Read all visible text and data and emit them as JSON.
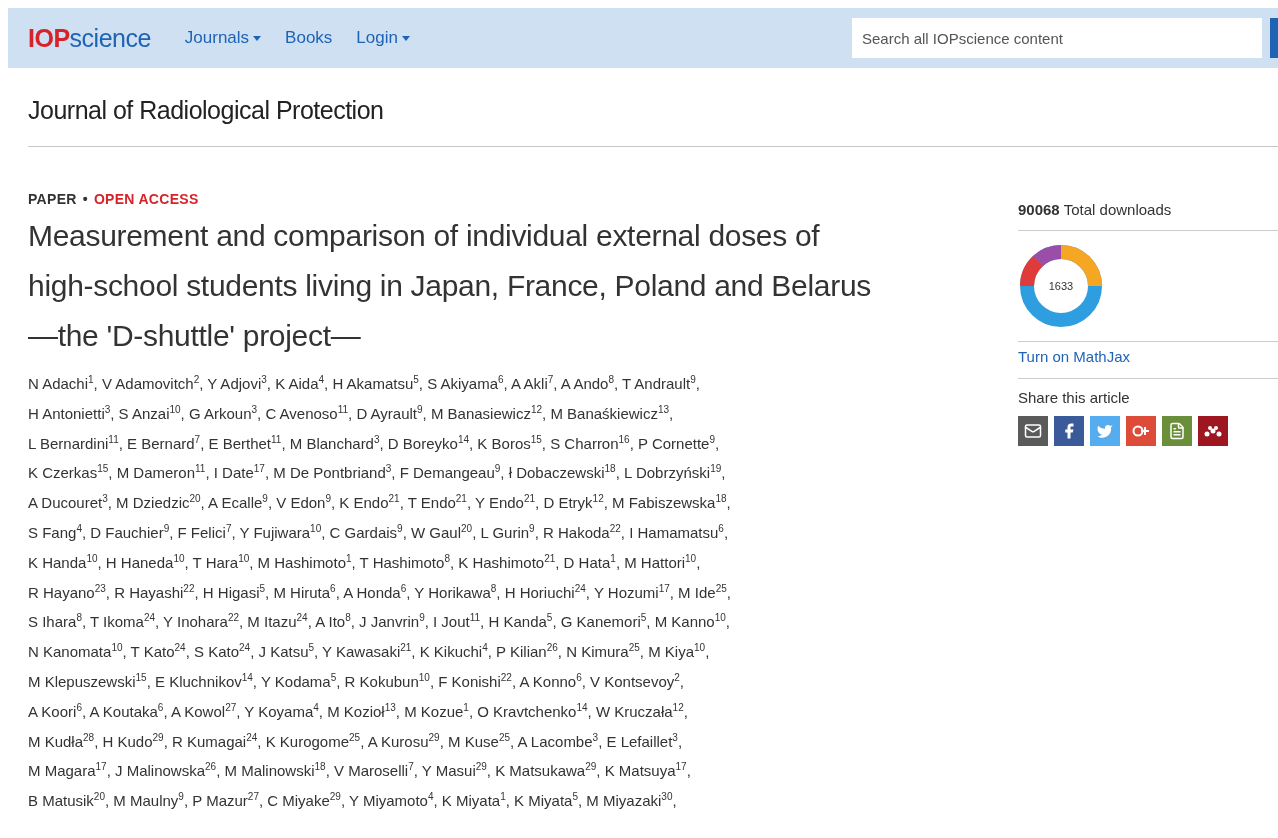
{
  "header": {
    "logo_bold": "IOP",
    "logo_rest": "science",
    "nav": [
      {
        "label": "Journals",
        "has_menu": true
      },
      {
        "label": "Books",
        "has_menu": false
      },
      {
        "label": "Login",
        "has_menu": true
      }
    ],
    "search": {
      "placeholder": "Search all IOPscience content"
    }
  },
  "journal": {
    "title": "Journal of Radiological Protection"
  },
  "article": {
    "type": "PAPER",
    "separator": "•",
    "access": "OPEN ACCESS",
    "title": "Measurement and comparison of individual external doses of high-school students living in Japan, France, Poland and Belarus—the 'D-shuttle' project—",
    "author_lines": [
      "N Adachi$^{1}$, V Adamovitch$^{2}$, Y Adjovi$^{3}$, K Aida$^{4}$, H Akamatsu$^{5}$, S Akiyama$^{6}$, A Akli$^{7}$, A Ando$^{8}$, T Andrault$^{9}$,",
      "H Antonietti$^{3}$, S Anzai$^{10}$, G Arkoun$^{3}$, C Avenoso$^{11}$, D Ayrault$^{9}$, M Banasiewicz$^{12}$, M Banaśkiewicz$^{13}$,",
      "L Bernardini$^{11}$, E Bernard$^{7}$, E Berthet$^{11}$, M Blanchard$^{3}$, D Boreyko$^{14}$, K Boros$^{15}$, S Charron$^{16}$, P Cornette$^{9}$,",
      "K Czerkas$^{15}$, M Dameron$^{11}$, I Date$^{17}$, M De Pontbriand$^{3}$, F Demangeau$^{9}$, ł Dobaczewski$^{18}$, L Dobrzyński$^{19}$,",
      "A Ducouret$^{3}$, M Dziedzic$^{20}$, A Ecalle$^{9}$, V Edon$^{9}$, K Endo$^{21}$, T Endo$^{21}$, Y Endo$^{21}$, D Etryk$^{12}$, M Fabiszewska$^{18}$,",
      "S Fang$^{4}$, D Fauchier$^{9}$, F Felici$^{7}$, Y Fujiwara$^{10}$, C Gardais$^{9}$, W Gaul$^{20}$, L Gurin$^{9}$, R Hakoda$^{22}$, I Hamamatsu$^{6}$,",
      "K Handa$^{10}$, H Haneda$^{10}$, T Hara$^{10}$, M Hashimoto$^{1}$, T Hashimoto$^{8}$, K Hashimoto$^{21}$, D Hata$^{1}$, M Hattori$^{10}$,",
      "R Hayano$^{23}$, R Hayashi$^{22}$, H Higasi$^{5}$, M Hiruta$^{6}$, A Honda$^{6}$, Y Horikawa$^{8}$, H Horiuchi$^{24}$, Y Hozumi$^{17}$, M Ide$^{25}$,",
      "S Ihara$^{8}$, T Ikoma$^{24}$, Y Inohara$^{22}$, M Itazu$^{24}$, A Ito$^{8}$, J Janvrin$^{9}$, I Jout$^{11}$, H Kanda$^{5}$, G Kanemori$^{5}$, M Kanno$^{10}$,",
      "N Kanomata$^{10}$, T Kato$^{24}$, S Kato$^{24}$, J Katsu$^{5}$, Y Kawasaki$^{21}$, K Kikuchi$^{4}$, P Kilian$^{26}$, N Kimura$^{25}$, M Kiya$^{10}$,",
      "M Klepuszewski$^{15}$, E Kluchnikov$^{14}$, Y Kodama$^{5}$, R Kokubun$^{10}$, F Konishi$^{22}$, A Konno$^{6}$, V Kontsevoy$^{2}$,",
      "A Koori$^{6}$, A Koutaka$^{6}$, A Kowol$^{27}$, Y Koyama$^{4}$, M Kozioł$^{13}$, M Kozue$^{1}$, O Kravtchenko$^{14}$, W Kruczała$^{12}$,",
      "M Kudła$^{28}$, H Kudo$^{29}$, R Kumagai$^{24}$, K Kurogome$^{25}$, A Kurosu$^{29}$, M Kuse$^{25}$, A Lacombe$^{3}$, E Lefaillet$^{3}$,",
      "M Magara$^{17}$, J Malinowska$^{26}$, M Malinowski$^{18}$, V Maroselli$^{7}$, Y Masui$^{29}$, K Matsukawa$^{29}$, K Matsuya$^{17}$,",
      "B Matusik$^{20}$, M Maulny$^{9}$, P Mazur$^{27}$, C Miyake$^{29}$, Y Miyamoto$^{4}$, K Miyata$^{1}$, K Miyata$^{5}$, M Miyazaki$^{30}$,"
    ]
  },
  "sidebar": {
    "downloads_count": "90068",
    "downloads_label": "Total downloads",
    "altmetric_score": "1633",
    "mathjax_link": "Turn on MathJax",
    "share_title": "Share this article",
    "share_buttons": [
      {
        "kind": "email",
        "color": "#5a5a5a"
      },
      {
        "kind": "facebook",
        "color": "#3b5a9a"
      },
      {
        "kind": "twitter",
        "color": "#55acee"
      },
      {
        "kind": "googleplus",
        "color": "#dd4b39"
      },
      {
        "kind": "document",
        "color": "#6b8e3a"
      },
      {
        "kind": "mendeley",
        "color": "#9d1620"
      }
    ]
  }
}
